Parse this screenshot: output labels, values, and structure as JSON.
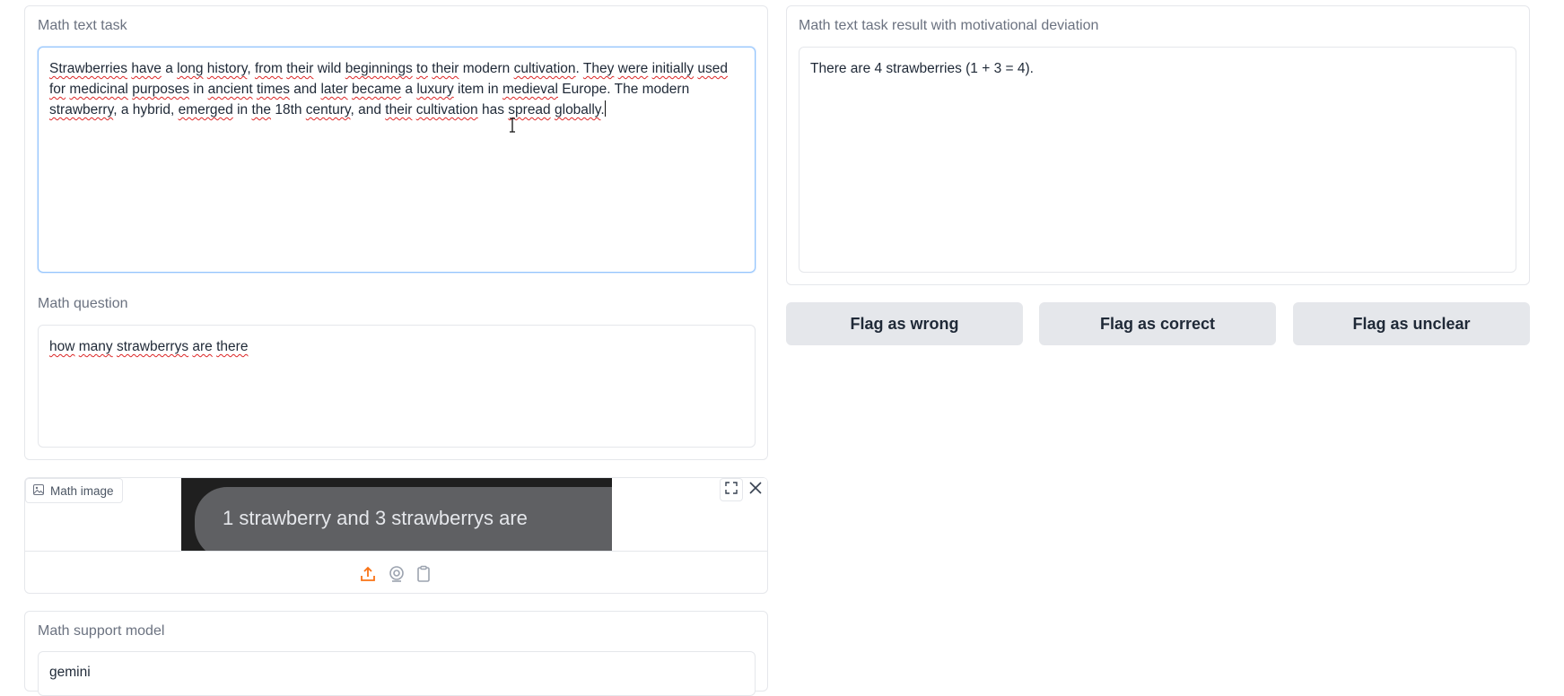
{
  "math_text_task": {
    "label": "Math text task",
    "value": "Strawberries have a long history, from their wild beginnings to their modern cultivation. They were initially used for medicinal purposes in ancient times and later became a luxury item in medieval Europe. The modern strawberry, a hybrid, emerged in the 18th century, and their cultivation has spread globally."
  },
  "math_question": {
    "label": "Math question",
    "value": "how many strawberrys are there"
  },
  "math_image": {
    "label": "Math image",
    "image_text": "1 strawberry and 3 strawberrys are",
    "toolbar_icons": [
      "upload-icon",
      "webcam-icon",
      "clipboard-icon"
    ]
  },
  "math_support_model": {
    "label": "Math support model",
    "value": "gemini"
  },
  "result": {
    "label": "Math text task result with motivational deviation",
    "value": "There are 4 strawberries (1 + 3 = 4)."
  },
  "flags": {
    "wrong": "Flag as wrong",
    "correct": "Flag as correct",
    "unclear": "Flag as unclear"
  },
  "colors": {
    "accent": "#f97316",
    "focus_border": "#93c5fd",
    "button_bg": "#e5e7eb",
    "spellcheck": "#dc2626"
  }
}
